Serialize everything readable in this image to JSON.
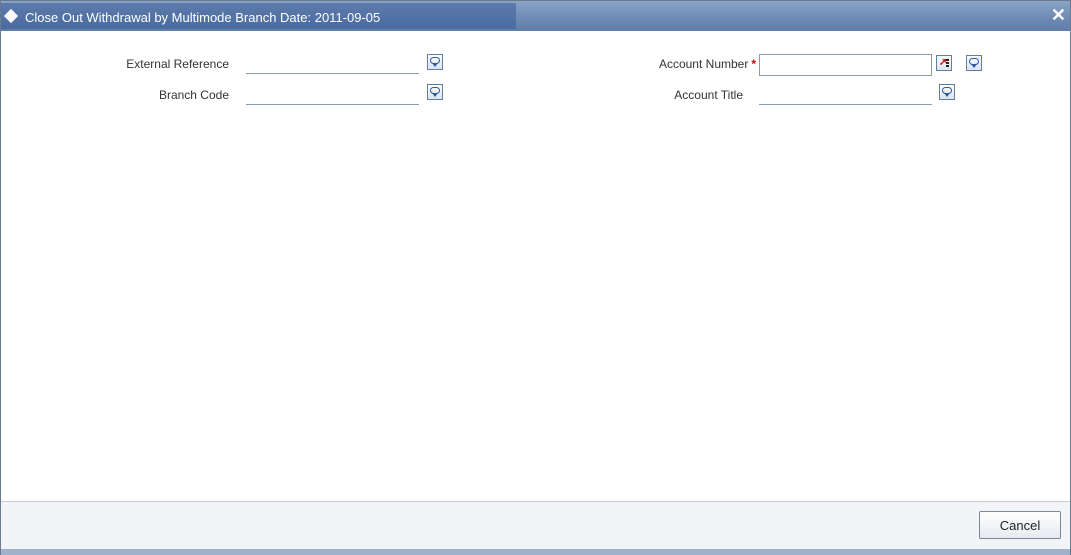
{
  "window": {
    "title": "Close Out Withdrawal by Multimode  Branch Date: 2011-09-05",
    "close_glyph": "✕"
  },
  "form": {
    "external_reference": {
      "label": "External Reference",
      "value": ""
    },
    "branch_code": {
      "label": "Branch Code",
      "value": ""
    },
    "account_number": {
      "label": "Account Number",
      "required_mark": "*",
      "value": ""
    },
    "account_title": {
      "label": "Account Title",
      "value": ""
    }
  },
  "footer": {
    "cancel_label": "Cancel"
  },
  "icons": {
    "field_help": "speech-bubble-icon",
    "list_of_values": "lov-arrow-icon"
  },
  "colors": {
    "title_bar": "#6d8ab3",
    "required": "#d40000",
    "icon_border": "#2b5aa8"
  }
}
